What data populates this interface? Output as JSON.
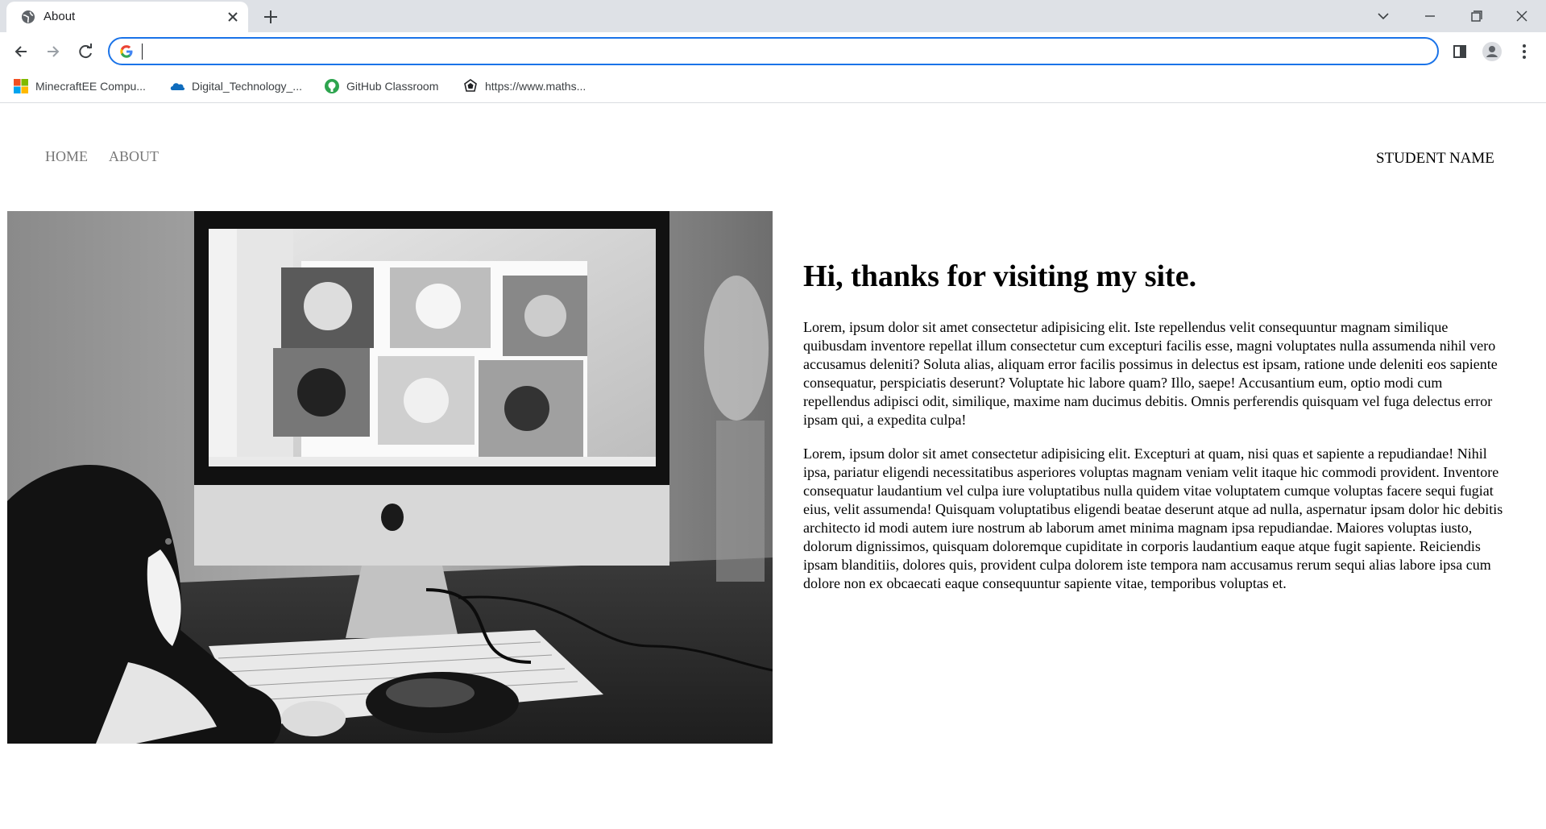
{
  "browser": {
    "tab_title": "About",
    "address_value": "",
    "bookmarks": [
      {
        "label": "MinecraftEE Compu...",
        "icon": "microsoft-logo-icon"
      },
      {
        "label": "Digital_Technology_...",
        "icon": "onedrive-cloud-icon"
      },
      {
        "label": "GitHub Classroom",
        "icon": "github-icon"
      },
      {
        "label": "https://www.maths...",
        "icon": "site-favicon-icon"
      }
    ],
    "accent_color": "#1a73e8"
  },
  "site": {
    "nav": [
      {
        "label": "HOME"
      },
      {
        "label": "ABOUT"
      }
    ],
    "student_name": "STUDENT NAME",
    "hero_image": "black-and-white photo of a cat looking at a computer screen showing a video call of cats",
    "headline": "Hi, thanks for visiting my site.",
    "paragraphs": [
      "Lorem, ipsum dolor sit amet consectetur adipisicing elit. Iste repellendus velit consequuntur magnam similique quibusdam inventore repellat illum consectetur cum excepturi facilis esse, magni voluptates nulla assumenda nihil vero accusamus deleniti? Soluta alias, aliquam error facilis possimus in delectus est ipsam, ratione unde deleniti eos sapiente consequatur, perspiciatis deserunt? Voluptate hic labore quam? Illo, saepe! Accusantium eum, optio modi cum repellendus adipisci odit, similique, maxime nam ducimus debitis. Omnis perferendis quisquam vel fuga delectus error ipsam qui, a expedita culpa!",
      "Lorem, ipsum dolor sit amet consectetur adipisicing elit. Excepturi at quam, nisi quas et sapiente a repudiandae! Nihil ipsa, pariatur eligendi necessitatibus asperiores voluptas magnam veniam velit itaque hic commodi provident. Inventore consequatur laudantium vel culpa iure voluptatibus nulla quidem vitae voluptatem cumque voluptas facere sequi fugiat eius, velit assumenda! Quisquam voluptatibus eligendi beatae deserunt atque ad nulla, aspernatur ipsam dolor hic debitis architecto id modi autem iure nostrum ab laborum amet minima magnam ipsa repudiandae. Maiores voluptas iusto, dolorum dignissimos, quisquam doloremque cupiditate in corporis laudantium eaque atque fugit sapiente. Reiciendis ipsam blanditiis, dolores quis, provident culpa dolorem iste tempora nam accusamus rerum sequi alias labore ipsa cum dolore non ex obcaecati eaque consequuntur sapiente vitae, temporibus voluptas et."
    ]
  }
}
